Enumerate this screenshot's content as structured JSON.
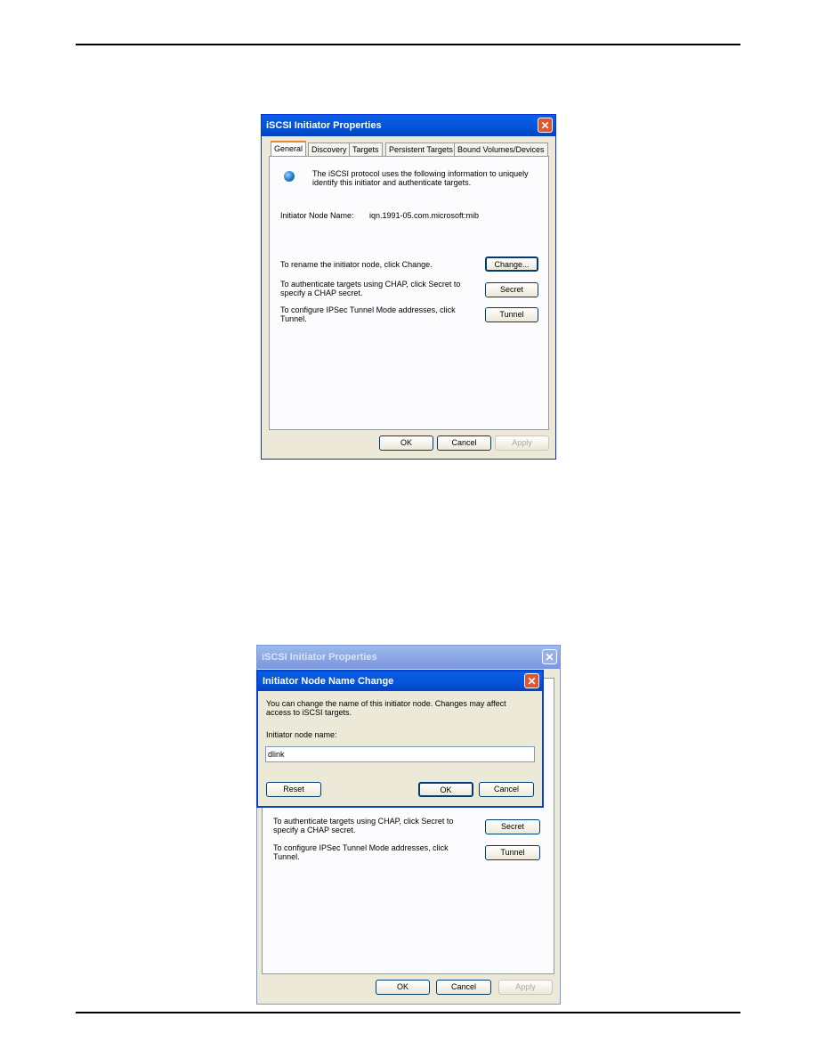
{
  "dialog1": {
    "title": "iSCSI Initiator Properties",
    "tabs": [
      "General",
      "Discovery",
      "Targets",
      "Persistent Targets",
      "Bound Volumes/Devices"
    ],
    "intro": "The iSCSI protocol uses the following information to uniquely identify this initiator and authenticate targets.",
    "node_label": "Initiator Node Name:",
    "node_value": "iqn.1991-05.com.microsoft:mib",
    "rename_text": "To rename the initiator node, click Change.",
    "chap_text": "To authenticate targets using CHAP, click Secret to specify a CHAP secret.",
    "ipsec_text": "To configure IPSec Tunnel Mode addresses, click Tunnel.",
    "change": "Change...",
    "secret": "Secret",
    "tunnel": "Tunnel",
    "ok": "OK",
    "cancel": "Cancel",
    "apply": "Apply"
  },
  "dialog2": {
    "title": "iSCSI Initiator Properties",
    "chap_text": "To authenticate targets using CHAP, click Secret to specify a CHAP secret.",
    "ipsec_text": "To configure IPSec Tunnel Mode addresses, click Tunnel.",
    "secret": "Secret",
    "tunnel": "Tunnel",
    "ok": "OK",
    "cancel": "Cancel",
    "apply": "Apply"
  },
  "change_dialog": {
    "title": "Initiator Node Name Change",
    "text": "You can change the name of this initiator node.  Changes may affect access to iSCSI targets.",
    "label": "Initiator node name:",
    "value": "dlink",
    "reset": "Reset",
    "ok": "OK",
    "cancel": "Cancel"
  },
  "icons": {
    "globe": "network-globe-icon",
    "close": "close-icon"
  }
}
